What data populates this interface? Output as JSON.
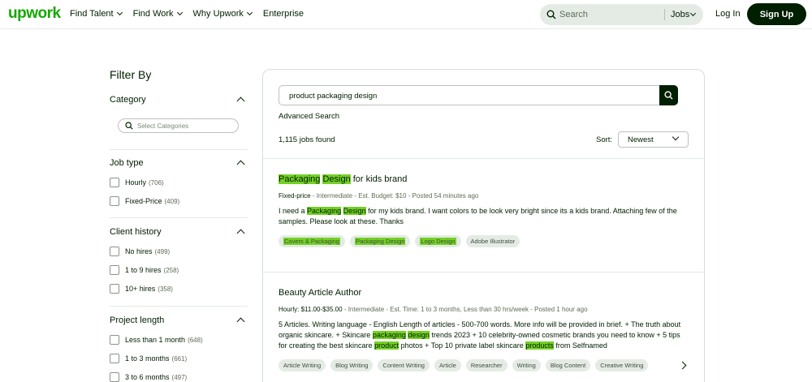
{
  "header": {
    "logo": "upwork",
    "nav": [
      "Find Talent",
      "Find Work",
      "Why Upwork",
      "Enterprise"
    ],
    "search_placeholder": "Search",
    "search_scope": "Jobs",
    "login": "Log In",
    "signup": "Sign Up"
  },
  "filters": {
    "title": "Filter By",
    "category": {
      "title": "Category",
      "placeholder": "Select Categories"
    },
    "job_type": {
      "title": "Job type",
      "options": [
        {
          "label": "Hourly",
          "count": "(706)"
        },
        {
          "label": "Fixed-Price",
          "count": "(409)"
        }
      ]
    },
    "client_history": {
      "title": "Client history",
      "options": [
        {
          "label": "No hires",
          "count": "(499)"
        },
        {
          "label": "1 to 9 hires",
          "count": "(258)"
        },
        {
          "label": "10+ hires",
          "count": "(358)"
        }
      ]
    },
    "project_length": {
      "title": "Project length",
      "options": [
        {
          "label": "Less than 1 month",
          "count": "(648)"
        },
        {
          "label": "1 to 3 months",
          "count": "(661)"
        },
        {
          "label": "3 to 6 months",
          "count": "(497)"
        }
      ]
    }
  },
  "results": {
    "query": "product packaging design",
    "advanced_search": "Advanced Search",
    "jobs_found_count": "1,115",
    "jobs_found_label": "jobs found",
    "sort_label": "Sort:",
    "sort_value": "Newest",
    "jobs": [
      {
        "title_hl1": "Packaging",
        "title_hl2": "Design",
        "title_rest": "for kids brand",
        "meta_type": "Fixed-price",
        "meta_rest": "- Intermediate - Est. Budget: $10 - Posted 54 minutes ago",
        "desc_a": "I need a",
        "desc_hl1": "Packaging",
        "desc_hl2": "Design",
        "desc_b": "for my kids brand. I want colors to be look very bright since its a kids brand. Attaching few of the samples. Please look at these. Thanks",
        "tags": [
          "Covers & Packaging",
          "Packaging Design",
          "Logo Design",
          "Adobe Illustrator"
        ]
      },
      {
        "title": "Beauty Article Author",
        "meta_type": "Hourly: $11.00-$35.00",
        "meta_rest": "- Intermediate - Est. Time: 1 to 3 months, Less than 30 hrs/week - Posted 1 hour ago",
        "desc_a": "5 Articles. Writing language - English Length of articles - 500-700 words. More info will be provided in brief. + The truth about organic skincare. + Skincare",
        "desc_hl1": "packaging",
        "desc_hl2": "design",
        "desc_b": "trends 2023 + 10 celebrity-owned cosmetic brands you need to know + 5 tips for creating the best skincare",
        "desc_hl3": "product",
        "desc_c": "photos + Top 10 private label skincare",
        "desc_hl4": "products",
        "desc_d": "from Selfnamed",
        "tags": [
          "Article Writing",
          "Blog Writing",
          "Content Writing",
          "Article",
          "Researcher",
          "Writing",
          "Blog Content",
          "Creative Writing"
        ]
      }
    ]
  }
}
